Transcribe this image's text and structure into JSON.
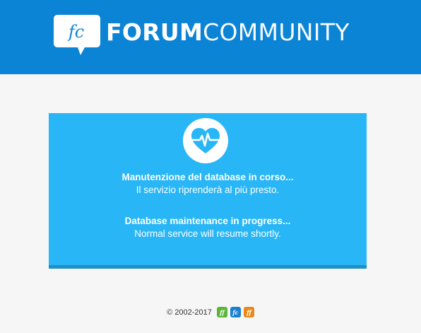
{
  "brand": {
    "logo_mark": "fc",
    "name_bold": "FORUM",
    "name_light": "COMMUNITY"
  },
  "maintenance": {
    "icon": "heart-pulse-icon",
    "italian_title": "Manutenzione del database in corso...",
    "italian_text": "Il servizio riprenderà al più presto.",
    "english_title": "Database maintenance in progress...",
    "english_text": "Normal service will resume shortly."
  },
  "footer": {
    "copyright": "© 2002-2017",
    "sites": [
      {
        "label": "ff",
        "color": "#5cb53a"
      },
      {
        "label": "fc",
        "color": "#1a7fcf"
      },
      {
        "label": "ff",
        "color": "#e8891c"
      }
    ]
  },
  "colors": {
    "header_bg": "#0b84d6",
    "card_bg": "#29b6f6",
    "card_border": "#1e8fc8",
    "page_bg": "#f6f6f6"
  }
}
